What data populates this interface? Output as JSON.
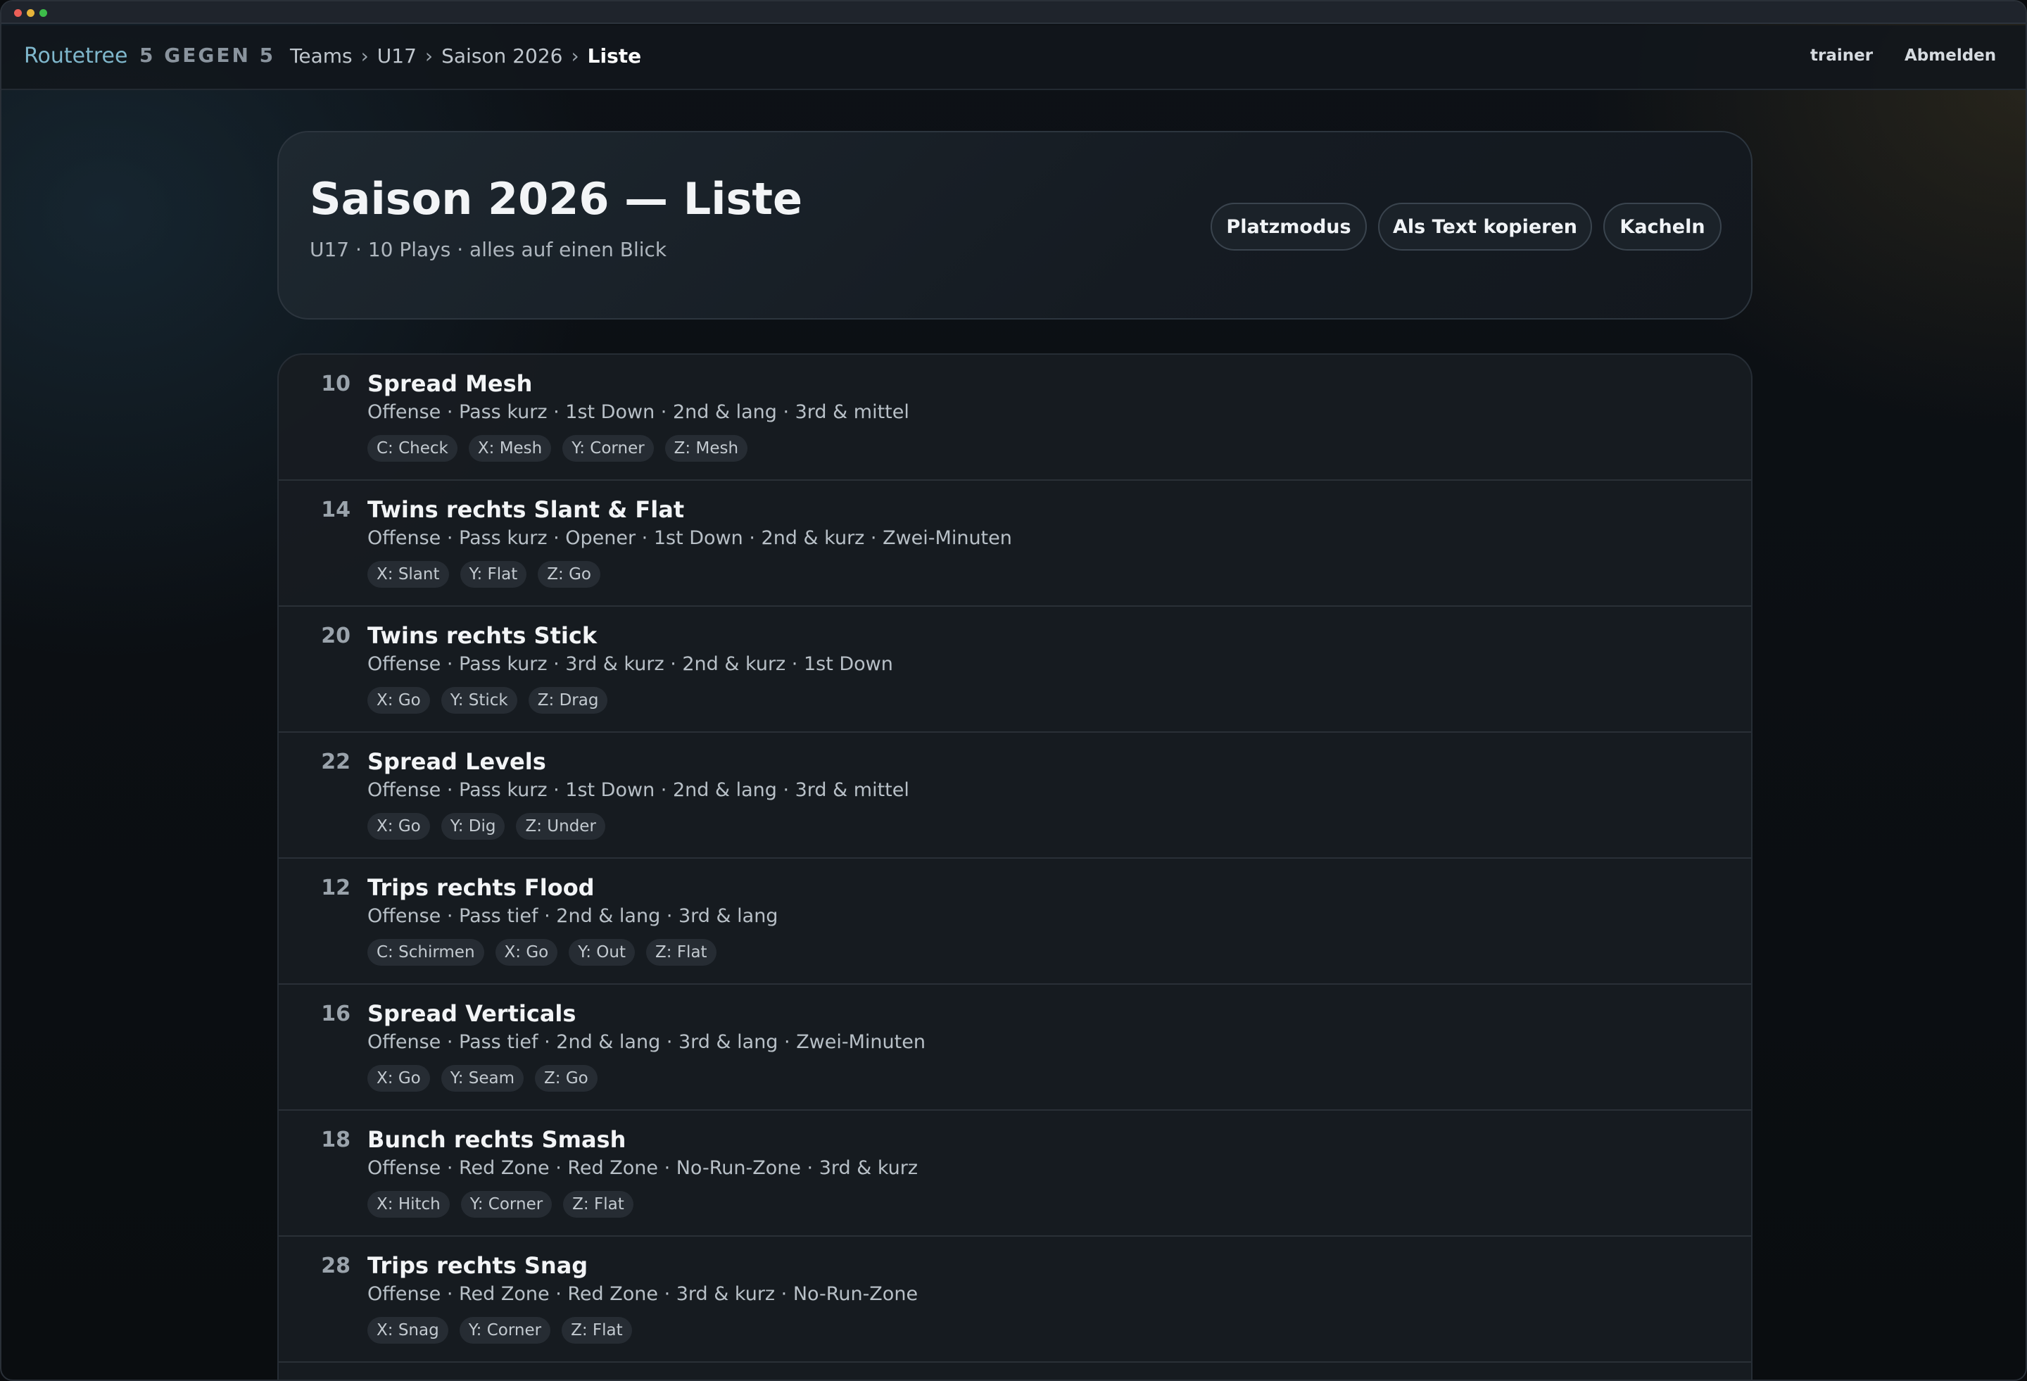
{
  "nav": {
    "brand": "Routetree",
    "brand_sub": "5 GEGEN 5",
    "breadcrumb": [
      "Teams",
      "U17",
      "Saison 2026",
      "Liste"
    ],
    "separator": "›",
    "user": "trainer",
    "logout": "Abmelden"
  },
  "hero": {
    "title": "Saison 2026 — Liste",
    "subtitle": "U17 · 10 Plays · alles auf einen Blick",
    "buttons": [
      "Platzmodus",
      "Als Text kopieren",
      "Kacheln"
    ]
  },
  "plays": [
    {
      "number": "10",
      "name": "Spread Mesh",
      "tags": "Offense · Pass kurz · 1st Down · 2nd & lang · 3rd & mittel",
      "routes": [
        "C: Check",
        "X: Mesh",
        "Y: Corner",
        "Z: Mesh"
      ]
    },
    {
      "number": "14",
      "name": "Twins rechts Slant & Flat",
      "tags": "Offense · Pass kurz · Opener · 1st Down · 2nd & kurz · Zwei-Minuten",
      "routes": [
        "X: Slant",
        "Y: Flat",
        "Z: Go"
      ]
    },
    {
      "number": "20",
      "name": "Twins rechts Stick",
      "tags": "Offense · Pass kurz · 3rd & kurz · 2nd & kurz · 1st Down",
      "routes": [
        "X: Go",
        "Y: Stick",
        "Z: Drag"
      ]
    },
    {
      "number": "22",
      "name": "Spread Levels",
      "tags": "Offense · Pass kurz · 1st Down · 2nd & lang · 3rd & mittel",
      "routes": [
        "X: Go",
        "Y: Dig",
        "Z: Under"
      ]
    },
    {
      "number": "12",
      "name": "Trips rechts Flood",
      "tags": "Offense · Pass tief · 2nd & lang · 3rd & lang",
      "routes": [
        "C: Schirmen",
        "X: Go",
        "Y: Out",
        "Z: Flat"
      ]
    },
    {
      "number": "16",
      "name": "Spread Verticals",
      "tags": "Offense · Pass tief · 2nd & lang · 3rd & lang · Zwei-Minuten",
      "routes": [
        "X: Go",
        "Y: Seam",
        "Z: Go"
      ]
    },
    {
      "number": "18",
      "name": "Bunch rechts Smash",
      "tags": "Offense · Red Zone · Red Zone · No-Run-Zone · 3rd & kurz",
      "routes": [
        "X: Hitch",
        "Y: Corner",
        "Z: Flat"
      ]
    },
    {
      "number": "28",
      "name": "Trips rechts Snag",
      "tags": "Offense · Red Zone · Red Zone · 3rd & kurz · No-Run-Zone",
      "routes": [
        "X: Snag",
        "Y: Corner",
        "Z: Flat"
      ]
    }
  ]
}
